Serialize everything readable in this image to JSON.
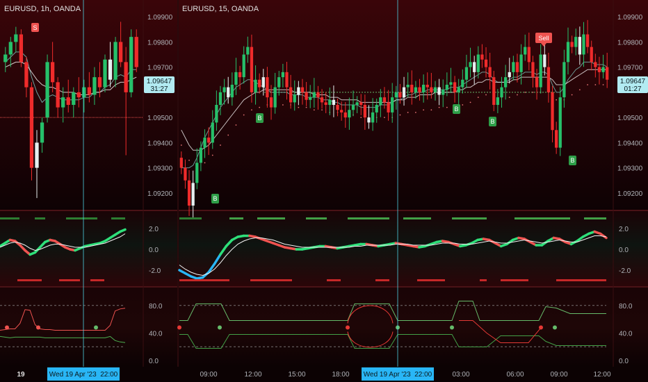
{
  "left_pane": {
    "symbol_label": "EURUSD, 1h, OANDA",
    "price_ticks": [
      "1.09900",
      "1.09800",
      "1.09700",
      "1.09500",
      "1.09400",
      "1.09300",
      "1.09200"
    ],
    "last_price": "1.09647",
    "countdown": "31:27",
    "osc_ticks": [
      "2.0",
      "0.0",
      "-2.0"
    ],
    "pct_ticks": [
      "80.0",
      "40.0",
      "0.0"
    ],
    "time_label": "19",
    "crosshair_label": "Wed 19 Apr '23  22:00",
    "signal_labels": [
      "S"
    ]
  },
  "right_pane": {
    "symbol_label": "EURUSD, 15, OANDA",
    "price_ticks": [
      "1.09900",
      "1.09800",
      "1.09700",
      "1.09500",
      "1.09400",
      "1.09300",
      "1.09200"
    ],
    "last_price": "1.09647",
    "countdown": "01:27",
    "osc_ticks": [
      "2.0",
      "0.0",
      "-2.0"
    ],
    "pct_ticks": [
      "80.0",
      "40.0",
      "0.0"
    ],
    "time_ticks": [
      "09:00",
      "12:00",
      "15:00",
      "18:00",
      "03:00",
      "06:00",
      "09:00",
      "12:00"
    ],
    "crosshair_label": "Wed 19 Apr '23  22:00",
    "signal_labels": [
      "Sell",
      "B",
      "B",
      "B",
      "B",
      "B"
    ]
  },
  "colors": {
    "bull": "#26c06a",
    "bear": "#ef2b2b",
    "doji_white": "#e6f0f0",
    "cyan": "#29b6f6",
    "last_price_bg": "#b2ebf2",
    "sell_badge": "#ef5350",
    "buy_badge": "#2e9e48"
  },
  "chart_data": [
    {
      "type": "candlestick",
      "title": "EURUSD, 1h, OANDA",
      "ylim": [
        1.0915,
        1.0995
      ],
      "y_ticks": [
        1.099,
        1.098,
        1.097,
        1.095,
        1.094,
        1.093,
        1.092
      ],
      "last_price": 1.09647,
      "x_tick_labels": [
        "19"
      ],
      "annotations": [
        {
          "text": "S",
          "type": "sell"
        }
      ],
      "ohlc": [
        [
          1.0972,
          1.0978,
          1.0968,
          1.0975
        ],
        [
          1.0975,
          1.0982,
          1.097,
          1.098
        ],
        [
          1.098,
          1.0986,
          1.0976,
          1.0983
        ],
        [
          1.0983,
          1.0985,
          1.097,
          1.0972
        ],
        [
          1.0972,
          1.0974,
          1.0958,
          1.0962
        ],
        [
          1.0962,
          1.0964,
          1.0925,
          1.093
        ],
        [
          1.093,
          1.0945,
          1.0918,
          1.094
        ],
        [
          1.094,
          1.095,
          1.0936,
          1.0948
        ],
        [
          1.095,
          1.0975,
          1.0948,
          1.0972
        ],
        [
          1.0972,
          1.098,
          1.096,
          1.0964
        ],
        [
          1.0964,
          1.0966,
          1.095,
          1.0954
        ],
        [
          1.0954,
          1.0962,
          1.0948,
          1.0958
        ],
        [
          1.0958,
          1.0965,
          1.0952,
          1.0955
        ],
        [
          1.0955,
          1.0962,
          1.095,
          1.096
        ],
        [
          1.096,
          1.0966,
          1.0954,
          1.0958
        ],
        [
          1.0958,
          1.0965,
          1.0952,
          1.0962
        ],
        [
          1.0962,
          1.0968,
          1.0956,
          1.0959
        ],
        [
          1.0959,
          1.097,
          1.0955,
          1.0966
        ],
        [
          1.0966,
          1.0972,
          1.0958,
          1.0962
        ],
        [
          1.0962,
          1.0975,
          1.096,
          1.0973
        ],
        [
          1.0973,
          1.098,
          1.0962,
          1.0965
        ],
        [
          1.0965,
          1.0982,
          1.0962,
          1.098
        ],
        [
          1.098,
          1.0988,
          1.097,
          1.0972
        ],
        [
          1.0972,
          1.0978,
          1.0935,
          1.096
        ],
        [
          1.096,
          1.0985,
          1.0958,
          1.0982
        ],
        [
          1.0982,
          1.0985,
          1.0968,
          1.097
        ]
      ],
      "moving_averages": [
        {
          "values": [
            1.0972,
            1.0974,
            1.0976,
            1.0976,
            1.0974,
            1.0966,
            1.096,
            1.0956,
            1.0958,
            1.0959,
            1.0958,
            1.0957,
            1.0957,
            1.0957,
            1.0957,
            1.0958,
            1.0958,
            1.096,
            1.096,
            1.0962,
            1.0963,
            1.0966,
            1.0967,
            1.0966,
            1.0969,
            1.0969
          ]
        },
        {
          "values": [
            1.097,
            1.0971,
            1.0972,
            1.0972,
            1.0971,
            1.0968,
            1.0965,
            1.0963,
            1.0962,
            1.0962,
            1.0961,
            1.096,
            1.096,
            1.096,
            1.0959,
            1.0959,
            1.0959,
            1.096,
            1.096,
            1.0961,
            1.0961,
            1.0963,
            1.0964,
            1.0964,
            1.0965,
            1.0966
          ]
        }
      ],
      "horizontal_level": 1.095
    },
    {
      "type": "candlestick",
      "title": "EURUSD, 15, OANDA",
      "ylim": [
        1.0915,
        1.0995
      ],
      "y_ticks": [
        1.099,
        1.098,
        1.097,
        1.095,
        1.094,
        1.093,
        1.092
      ],
      "last_price": 1.09647,
      "x_tick_labels": [
        "09:00",
        "12:00",
        "15:00",
        "18:00",
        "03:00",
        "06:00",
        "09:00",
        "12:00"
      ],
      "annotations": [
        {
          "text": "Sell",
          "type": "sell"
        },
        {
          "text": "B",
          "type": "buy"
        },
        {
          "text": "B",
          "type": "buy"
        },
        {
          "text": "B",
          "type": "buy"
        },
        {
          "text": "B",
          "type": "buy"
        },
        {
          "text": "B",
          "type": "buy"
        }
      ],
      "close": [
        1.093,
        1.0925,
        1.0915,
        1.0924,
        1.0932,
        1.0938,
        1.0942,
        1.094,
        1.0948,
        1.0955,
        1.096,
        1.0962,
        1.0958,
        1.0963,
        1.0968,
        1.0966,
        1.0975,
        1.0978,
        1.096,
        1.0965,
        1.0962,
        1.0966,
        1.0958,
        1.0954,
        1.0962,
        1.0966,
        1.0968,
        1.0962,
        1.0956,
        1.0959,
        1.0962,
        1.096,
        1.0957,
        1.0958,
        1.096,
        1.0958,
        1.0956,
        1.0955,
        1.0957,
        1.0955,
        1.0953,
        1.0952,
        1.095,
        1.0953,
        1.0955,
        1.0956,
        1.0955,
        1.095,
        1.0948,
        1.0952,
        1.0955,
        1.0958,
        1.0956,
        1.0952,
        1.0958,
        1.096,
        1.0958,
        1.0962,
        1.0963,
        1.096,
        1.0962,
        1.096,
        1.0963,
        1.0962,
        1.096,
        1.0962,
        1.0959,
        1.0961,
        1.0963,
        1.0964,
        1.096,
        1.0962,
        1.0965,
        1.097,
        1.0972,
        1.0968,
        1.0975,
        1.0973,
        1.097,
        1.0966,
        1.0955,
        1.0958,
        1.0962,
        1.0966,
        1.0968,
        1.0972,
        1.0968,
        1.0975,
        1.0978,
        1.0972,
        1.0966,
        1.0962,
        1.0975,
        1.097,
        1.096,
        1.0945,
        1.0938,
        1.0958,
        1.0972,
        1.098,
        1.0978,
        1.0982,
        1.0975,
        1.0983,
        1.0978,
        1.0972,
        1.097,
        1.0968,
        1.097,
        1.0965
      ],
      "moving_averages": [
        {
          "values": [
            1.093,
            1.093,
            1.093,
            1.0931,
            1.0934,
            1.0938,
            1.0942,
            1.0945,
            1.0948,
            1.0951,
            1.0954,
            1.0956,
            1.0958,
            1.096,
            1.0962,
            1.0963,
            1.0964,
            1.0965,
            1.0965,
            1.0964,
            1.0963,
            1.0962,
            1.0961,
            1.096,
            1.096,
            1.096,
            1.096,
            1.096,
            1.0959,
            1.0959,
            1.0959,
            1.0959,
            1.0958,
            1.0958,
            1.0958,
            1.0958,
            1.0957,
            1.0957,
            1.0957,
            1.0956,
            1.0956,
            1.0955,
            1.0955,
            1.0955,
            1.0955,
            1.0955,
            1.0954,
            1.0954,
            1.0954,
            1.0954,
            1.0954,
            1.0955,
            1.0955,
            1.0955,
            1.0956,
            1.0957,
            1.0957,
            1.0958,
            1.0959,
            1.0959,
            1.096,
            1.096,
            1.096,
            1.0961,
            1.0961,
            1.0961,
            1.0961,
            1.0961,
            1.0961,
            1.0962,
            1.0962,
            1.0962,
            1.0963,
            1.0964,
            1.0965,
            1.0966,
            1.0967,
            1.0968,
            1.0968,
            1.0967,
            1.0965,
            1.0964,
            1.0964,
            1.0964,
            1.0965,
            1.0966,
            1.0966,
            1.0967,
            1.0968,
            1.0968,
            1.0968,
            1.0967,
            1.0968,
            1.0968,
            1.0967,
            1.0963,
            1.096,
            1.096,
            1.0962,
            1.0965,
            1.0967,
            1.0969,
            1.097,
            1.0972,
            1.0972,
            1.0972,
            1.0971,
            1.0971,
            1.0971,
            1.097
          ]
        },
        {
          "values": [
            1.0945,
            1.0942,
            1.0939,
            1.0937,
            1.0937,
            1.0937,
            1.0938,
            1.0939,
            1.0941,
            1.0943,
            1.0945,
            1.0947,
            1.0949,
            1.0951,
            1.0953,
            1.0955,
            1.0957,
            1.0958,
            1.0959,
            1.096,
            1.096,
            1.0961,
            1.0961,
            1.0961,
            1.0961,
            1.0961,
            1.0961,
            1.0961,
            1.0961,
            1.096,
            1.096,
            1.096,
            1.096,
            1.096,
            1.0959,
            1.0959,
            1.0959,
            1.0959,
            1.0958,
            1.0958,
            1.0958,
            1.0957,
            1.0957,
            1.0957,
            1.0957,
            1.0957,
            1.0956,
            1.0956,
            1.0956,
            1.0956,
            1.0956,
            1.0956,
            1.0956,
            1.0956,
            1.0956,
            1.0957,
            1.0957,
            1.0957,
            1.0958,
            1.0958,
            1.0958,
            1.0959,
            1.0959,
            1.0959,
            1.0959,
            1.096,
            1.096,
            1.096,
            1.096,
            1.096,
            1.096,
            1.0961,
            1.0961,
            1.0962,
            1.0962,
            1.0963,
            1.0964,
            1.0964,
            1.0965,
            1.0965,
            1.0964,
            1.0964,
            1.0964,
            1.0964,
            1.0964,
            1.0965,
            1.0965,
            1.0966,
            1.0966,
            1.0966,
            1.0966,
            1.0966,
            1.0966,
            1.0966,
            1.0966,
            1.0965,
            1.0963,
            1.0963,
            1.0963,
            1.0964,
            1.0965,
            1.0966,
            1.0967,
            1.0968,
            1.0969,
            1.0969,
            1.0969,
            1.0969,
            1.0969,
            1.0969
          ]
        }
      ],
      "horizontal_level": 1.096
    },
    {
      "type": "line",
      "name": "oscillator_left",
      "ylim": [
        -3,
        3
      ],
      "y_ticks": [
        2,
        0,
        -2
      ],
      "series": [
        {
          "values": [
            0.3,
            0.6,
            0.9,
            0.8,
            0.4,
            -0.1,
            -0.5,
            -0.3,
            0.2,
            0.7,
            0.9,
            0.8,
            0.5,
            0.2,
            0.0,
            -0.1,
            0.1,
            0.3,
            0.4,
            0.5,
            0.6,
            0.8,
            1.1,
            1.4,
            1.7,
            1.9
          ]
        },
        {
          "values": [
            0.2,
            0.4,
            0.6,
            0.7,
            0.6,
            0.4,
            0.1,
            -0.1,
            0.0,
            0.2,
            0.4,
            0.5,
            0.5,
            0.4,
            0.3,
            0.2,
            0.2,
            0.2,
            0.3,
            0.4,
            0.5,
            0.6,
            0.8,
            1.0,
            1.2,
            1.5
          ]
        }
      ]
    },
    {
      "type": "line",
      "name": "oscillator_right",
      "ylim": [
        -3,
        3
      ],
      "y_ticks": [
        2,
        0,
        -2
      ],
      "series": [
        {
          "values": [
            -2.0,
            -2.3,
            -2.6,
            -2.8,
            -2.7,
            -2.2,
            -1.4,
            -0.5,
            0.3,
            0.9,
            1.2,
            1.3,
            1.3,
            1.2,
            1.0,
            0.8,
            0.6,
            0.4,
            0.2,
            0.1,
            0.0,
            0.0,
            0.1,
            0.2,
            0.3,
            0.3,
            0.2,
            0.1,
            0.2,
            0.3,
            0.4,
            0.5,
            0.5,
            0.4,
            0.3,
            0.4,
            0.5,
            0.6,
            0.5,
            0.4,
            0.3,
            0.2,
            0.3,
            0.5,
            0.7,
            0.8,
            0.7,
            0.5,
            0.3,
            0.4,
            0.6,
            0.9,
            1.0,
            0.9,
            0.6,
            0.3,
            0.5,
            0.9,
            1.1,
            1.0,
            0.7,
            0.4,
            0.4,
            0.8,
            1.1,
            1.0,
            0.7,
            0.5,
            0.8,
            1.2,
            1.5,
            1.7,
            1.5,
            1.1
          ]
        },
        {
          "values": [
            -1.5,
            -1.9,
            -2.2,
            -2.4,
            -2.5,
            -2.3,
            -1.9,
            -1.3,
            -0.6,
            0.0,
            0.5,
            0.8,
            1.0,
            1.1,
            1.1,
            1.0,
            0.9,
            0.7,
            0.5,
            0.4,
            0.3,
            0.2,
            0.2,
            0.2,
            0.2,
            0.2,
            0.2,
            0.2,
            0.2,
            0.2,
            0.3,
            0.3,
            0.4,
            0.4,
            0.4,
            0.4,
            0.4,
            0.5,
            0.5,
            0.5,
            0.4,
            0.4,
            0.4,
            0.4,
            0.5,
            0.6,
            0.6,
            0.6,
            0.5,
            0.5,
            0.5,
            0.6,
            0.7,
            0.8,
            0.7,
            0.6,
            0.6,
            0.7,
            0.8,
            0.9,
            0.8,
            0.7,
            0.6,
            0.7,
            0.8,
            0.9,
            0.8,
            0.7,
            0.7,
            0.9,
            1.1,
            1.3,
            1.3,
            1.2
          ]
        }
      ]
    },
    {
      "type": "line",
      "name": "percent_band_left",
      "ylim": [
        -5,
        100
      ],
      "y_ticks": [
        80,
        40,
        0
      ],
      "dashed_levels": [
        80,
        20
      ],
      "series": [
        {
          "values": [
            44,
            45,
            46,
            46,
            54,
            74,
            73,
            52,
            46,
            45,
            45,
            44,
            44,
            44,
            44,
            44,
            44,
            44,
            44,
            44,
            44,
            44,
            51,
            72,
            75,
            76
          ]
        },
        {
          "values": [
            35,
            34,
            33,
            34,
            34,
            34,
            34,
            34,
            34,
            33,
            33,
            33,
            33,
            33,
            33,
            33,
            33,
            33,
            33,
            33,
            33,
            33,
            35,
            29,
            27,
            26
          ]
        },
        {
          "values": [
            48,
            48,
            48,
            48,
            48,
            48,
            48,
            48,
            48,
            48,
            48,
            48,
            48,
            48,
            48,
            48,
            48,
            48,
            48,
            48,
            48,
            48,
            48,
            48,
            48,
            48
          ]
        }
      ]
    },
    {
      "type": "line",
      "name": "percent_band_right",
      "ylim": [
        -5,
        100
      ],
      "y_ticks": [
        80,
        40,
        0
      ],
      "dashed_levels": [
        80,
        20
      ],
      "series": [
        {
          "values": [
            48,
            48,
            48,
            48,
            48,
            48,
            48,
            48,
            48,
            48,
            48,
            48,
            48,
            48,
            48,
            48,
            48,
            48,
            48,
            48,
            48,
            48,
            48,
            48,
            48,
            48,
            48,
            48,
            48,
            48,
            48,
            48,
            48,
            48,
            48,
            48,
            48,
            48,
            48,
            48,
            48,
            48,
            48,
            48,
            48,
            48,
            48,
            48,
            48,
            48,
            48,
            48,
            48,
            48,
            48,
            48,
            48,
            48,
            48,
            48,
            48,
            48,
            48,
            48,
            48,
            48,
            48,
            48,
            48,
            48,
            48,
            48,
            48,
            48
          ]
        }
      ]
    }
  ]
}
